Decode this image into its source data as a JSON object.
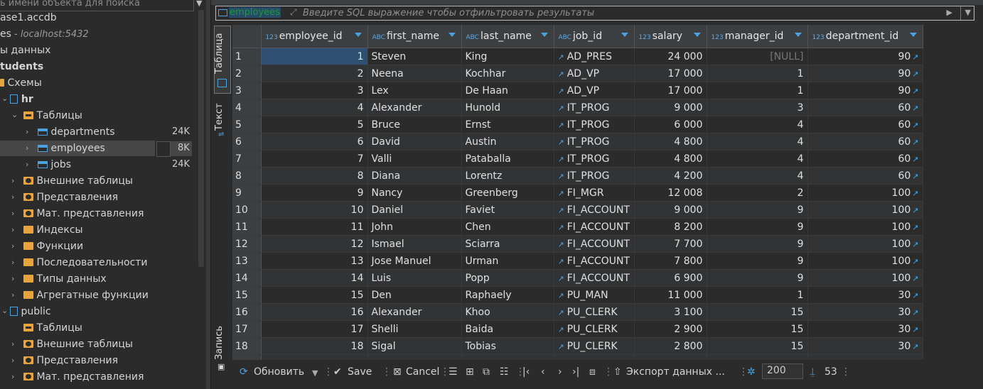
{
  "navigator": {
    "search_placeholder": "ь имени объекта для поиска",
    "items": [
      {
        "label": "ase1.accdb"
      },
      {
        "label": "es",
        "suffix": " - localhost:5432"
      },
      {
        "label": "ы данных"
      },
      {
        "label": "tudents"
      },
      {
        "label": "Схемы"
      },
      {
        "label": "hr"
      },
      {
        "label": "Таблицы"
      },
      {
        "label": "departments",
        "size": "24K"
      },
      {
        "label": "employees",
        "size": "8K"
      },
      {
        "label": "jobs",
        "size": "24K"
      },
      {
        "label": "Внешние таблицы"
      },
      {
        "label": "Представления"
      },
      {
        "label": "Мат. представления"
      },
      {
        "label": "Индексы"
      },
      {
        "label": "Функции"
      },
      {
        "label": "Последовательности"
      },
      {
        "label": "Типы данных"
      },
      {
        "label": "Агрегатные функции"
      },
      {
        "label": "public"
      },
      {
        "label": "Таблицы"
      },
      {
        "label": "Внешние таблицы"
      },
      {
        "label": "Представления"
      },
      {
        "label": "Мат. представления"
      }
    ]
  },
  "editor": {
    "table_name": "employees",
    "filter_placeholder": "Введите SQL выражение чтобы отфильтровать результаты",
    "side_tabs": {
      "table": "Таблица",
      "text": "Текст",
      "record": "Запись"
    }
  },
  "grid": {
    "columns": [
      {
        "type": "123",
        "name": "employee_id"
      },
      {
        "type": "ABC",
        "name": "first_name"
      },
      {
        "type": "ABC",
        "name": "last_name"
      },
      {
        "type": "ABC",
        "name": "job_id"
      },
      {
        "type": "123",
        "name": "salary"
      },
      {
        "type": "123",
        "name": "manager_id"
      },
      {
        "type": "123",
        "name": "department_id"
      }
    ],
    "rows": [
      [
        "1",
        "1",
        "Steven",
        "King",
        "AD_PRES",
        "24 000",
        "[NULL]",
        "90"
      ],
      [
        "2",
        "2",
        "Neena",
        "Kochhar",
        "AD_VP",
        "17 000",
        "1",
        "90"
      ],
      [
        "3",
        "3",
        "Lex",
        "De Haan",
        "AD_VP",
        "17 000",
        "1",
        "90"
      ],
      [
        "4",
        "4",
        "Alexander",
        "Hunold",
        "IT_PROG",
        "9 000",
        "3",
        "60"
      ],
      [
        "5",
        "5",
        "Bruce",
        "Ernst",
        "IT_PROG",
        "6 000",
        "4",
        "60"
      ],
      [
        "6",
        "6",
        "David",
        "Austin",
        "IT_PROG",
        "4 800",
        "4",
        "60"
      ],
      [
        "7",
        "7",
        "Valli",
        "Pataballa",
        "IT_PROG",
        "4 800",
        "4",
        "60"
      ],
      [
        "8",
        "8",
        "Diana",
        "Lorentz",
        "IT_PROG",
        "4 200",
        "4",
        "60"
      ],
      [
        "9",
        "9",
        "Nancy",
        "Greenberg",
        "FI_MGR",
        "12 008",
        "2",
        "100"
      ],
      [
        "10",
        "10",
        "Daniel",
        "Faviet",
        "FI_ACCOUNT",
        "9 000",
        "9",
        "100"
      ],
      [
        "11",
        "11",
        "John",
        "Chen",
        "FI_ACCOUNT",
        "8 200",
        "9",
        "100"
      ],
      [
        "12",
        "12",
        "Ismael",
        "Sciarra",
        "FI_ACCOUNT",
        "7 700",
        "9",
        "100"
      ],
      [
        "13",
        "13",
        "Jose Manuel",
        "Urman",
        "FI_ACCOUNT",
        "7 800",
        "9",
        "100"
      ],
      [
        "14",
        "14",
        "Luis",
        "Popp",
        "FI_ACCOUNT",
        "6 900",
        "9",
        "100"
      ],
      [
        "15",
        "15",
        "Den",
        "Raphaely",
        "PU_MAN",
        "11 000",
        "1",
        "30"
      ],
      [
        "16",
        "16",
        "Alexander",
        "Khoo",
        "PU_CLERK",
        "3 100",
        "15",
        "30"
      ],
      [
        "17",
        "17",
        "Shelli",
        "Baida",
        "PU_CLERK",
        "2 900",
        "15",
        "30"
      ],
      [
        "18",
        "18",
        "Sigal",
        "Tobias",
        "PU_CLERK",
        "2 800",
        "15",
        "30"
      ]
    ]
  },
  "toolbar": {
    "refresh": "Обновить",
    "save": "Save",
    "cancel": "Cancel",
    "export": "Экспорт данных ...",
    "fetch_size": "200",
    "row_count": "53"
  }
}
